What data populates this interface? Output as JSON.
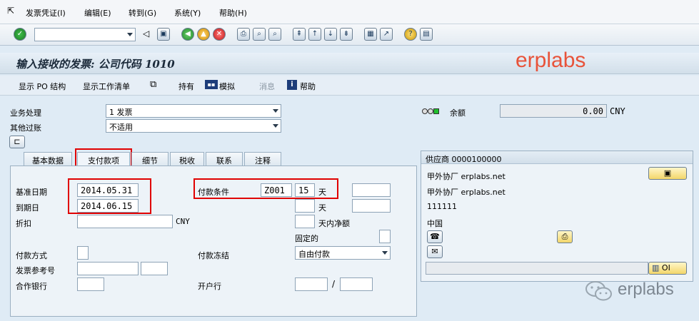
{
  "menu": {
    "items": [
      "发票凭证(I)",
      "编辑(E)",
      "转到(G)",
      "系统(Y)",
      "帮助(H)"
    ]
  },
  "title": "输入接收的发票: 公司代码 1010",
  "watermark_top": "erplabs",
  "watermark_bottom": "erplabs",
  "appbar": {
    "show_po": "显示 PO 结构",
    "show_worklist": "显示工作清单",
    "hold": "持有",
    "simulate": "模拟",
    "messages": "消息",
    "help": "帮助"
  },
  "header": {
    "transaction_label": "业务处理",
    "transaction_value": "1 发票",
    "other_posting_label": "其他过账",
    "other_posting_value": "不适用",
    "balance_label": "余额",
    "balance_value": "0.00",
    "balance_currency": "CNY"
  },
  "tabs": [
    "基本数据",
    "支付款项",
    "细节",
    "税收",
    "联系",
    "注释"
  ],
  "payment": {
    "baseline_date_label": "基准日期",
    "baseline_date_value": "2014.05.31",
    "due_date_label": "到期日",
    "due_date_value": "2014.06.15",
    "discount_label": "折扣",
    "discount_currency": "CNY",
    "payment_terms_label": "付款条件",
    "payment_terms_value": "Z001",
    "days_value": "15",
    "days_unit": "天",
    "days_unit2": "天",
    "net_days_label": "天内净额",
    "fixed_label": "固定的",
    "payment_method_label": "付款方式",
    "payment_block_label": "付款冻结",
    "payment_block_value": "自由付款",
    "invoice_ref_label": "发票参考号",
    "partner_bank_label": "合作银行",
    "house_bank_label": "开户行",
    "slash": "/"
  },
  "vendor": {
    "title": "供应商 0000100000",
    "line1": "甲外协厂 erplabs.net",
    "line2": "甲外协厂 erplabs.net",
    "line3": "111111",
    "line4": "中国",
    "oi_label": "OI"
  },
  "colors": {
    "accent_red": "#e00000",
    "watermark": "#e8533a"
  }
}
